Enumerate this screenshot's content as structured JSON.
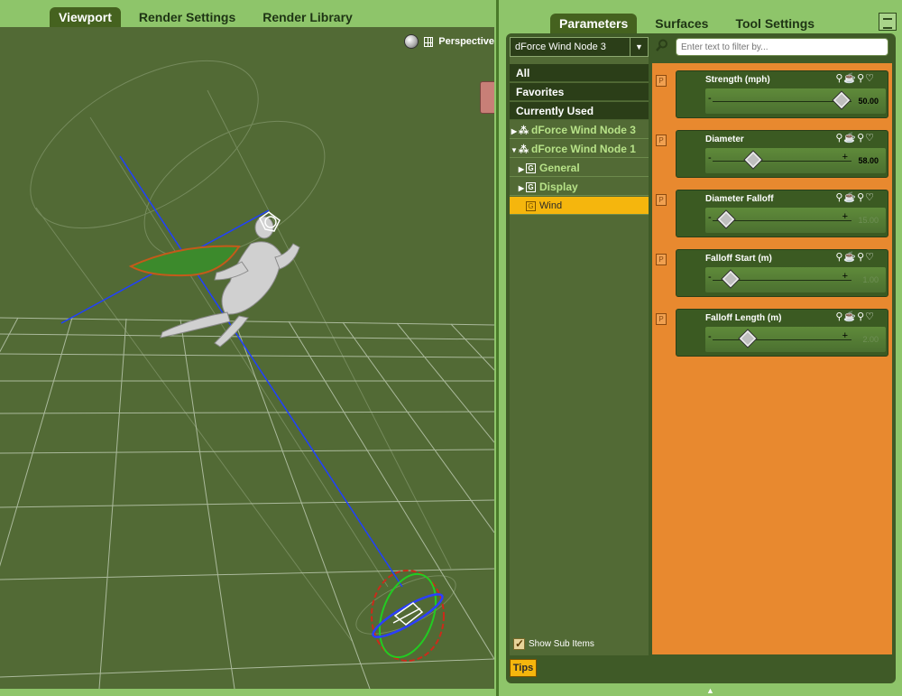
{
  "left_tabs": [
    "Viewport",
    "Render Settings",
    "Render Library"
  ],
  "viewport": {
    "camera_label": "Perspective"
  },
  "right_tabs": [
    "Parameters",
    "Surfaces",
    "Tool Settings"
  ],
  "node_selector": {
    "value": "dForce Wind Node 3"
  },
  "filter": {
    "placeholder": "Enter text to filter by..."
  },
  "categories": [
    "All",
    "Favorites",
    "Currently Used"
  ],
  "tree": [
    {
      "label": "dForce Wind Node 3",
      "level": 0,
      "expanded": false
    },
    {
      "label": "dForce Wind Node 1",
      "level": 0,
      "expanded": true
    },
    {
      "label": "General",
      "level": 1
    },
    {
      "label": "Display",
      "level": 1
    },
    {
      "label": "Wind",
      "level": 1,
      "selected": true
    }
  ],
  "parameters": [
    {
      "name": "Strength (mph)",
      "value": "50.00",
      "fraction": 0.93,
      "active": true
    },
    {
      "name": "Diameter",
      "value": "58.00",
      "fraction": 0.29,
      "active": true
    },
    {
      "name": "Diameter Falloff",
      "value": "15.00",
      "fraction": 0.1,
      "active": false
    },
    {
      "name": "Falloff Start (m)",
      "value": "1.00",
      "fraction": 0.13,
      "active": false
    },
    {
      "name": "Falloff Length (m)",
      "value": "2.00",
      "fraction": 0.25,
      "active": false
    }
  ],
  "param_marker": "P",
  "show_sub_items": {
    "label": "Show Sub Items",
    "checked": true
  },
  "tips_label": "Tips",
  "colors": {
    "panel_green": "#8ec56a",
    "viewport_bg": "#526a35",
    "props_orange": "#e8892f",
    "selected_yellow": "#f5b60d"
  }
}
